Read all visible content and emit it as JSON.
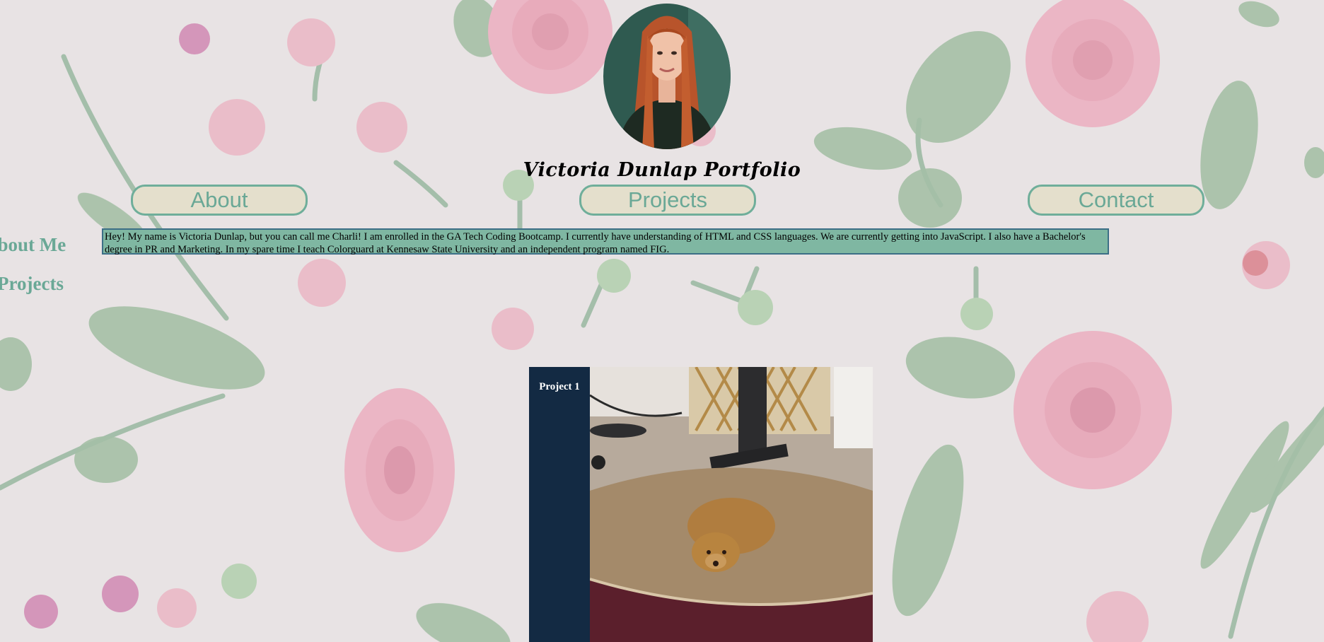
{
  "header": {
    "title": "Victoria Dunlap Portfolio"
  },
  "nav": {
    "about_label": "About",
    "projects_label": "Projects",
    "contact_label": "Contact"
  },
  "sidebar": {
    "items": [
      {
        "label": "About Me"
      },
      {
        "label": "Projects"
      }
    ]
  },
  "about": {
    "text": "Hey! My name is Victoria Dunlap, but you can call me Charli! I am enrolled in the GA Tech Coding Bootcamp. I currently have understanding of HTML and CSS languages. We are currently getting into JavaScript. I also have a Bachelor's degree in PR and Marketing. In my spare time I teach Colorguard at Kennesaw State University and an independent program named FIG."
  },
  "projects": [
    {
      "label": "Project 1"
    }
  ],
  "colors": {
    "accent_teal": "#6aa896",
    "about_box_bg": "#7fb7a2",
    "nav_button_bg": "#e4dfcc",
    "project_panel_bg": "#132a43"
  }
}
